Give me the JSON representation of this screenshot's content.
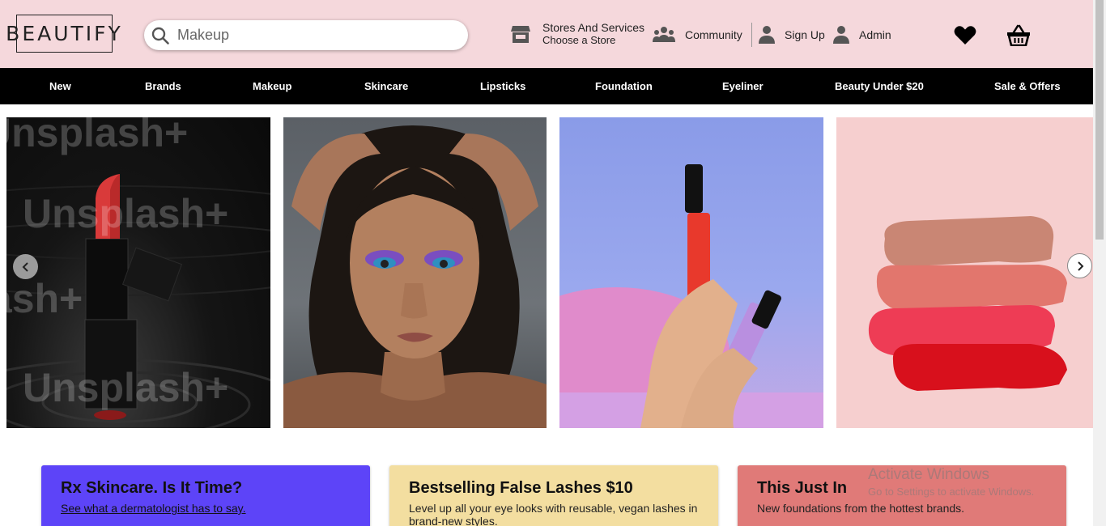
{
  "header": {
    "logo": "BEAUTIFY",
    "search": {
      "placeholder": "Makeup",
      "value": ""
    },
    "store": {
      "line1": "Stores And Services",
      "line2": "Choose a Store"
    },
    "community": "Community",
    "signup": "Sign Up",
    "admin": "Admin"
  },
  "nav": [
    "New",
    "Brands",
    "Makeup",
    "Skincare",
    "Lipsticks",
    "Foundation",
    "Eyeliner",
    "Beauty Under $20",
    "Sale & Offers"
  ],
  "carousel": {
    "watermark": "Unsplash+",
    "slides": [
      "lipstick-photo",
      "makeup-model-photo",
      "lip-gloss-hands-photo",
      "lipstick-swatches-photo"
    ]
  },
  "promos": [
    {
      "title": "Rx Skincare. Is It Time?",
      "text": "See what a dermatologist has to say."
    },
    {
      "title": "Bestselling False Lashes $10",
      "text": "Level up all your eye looks with reusable, vegan lashes in brand-new styles."
    },
    {
      "title": "This Just In",
      "text": "New foundations from the hottest brands."
    }
  ],
  "watermark": {
    "line1": "Activate Windows",
    "line2": "Go to Settings to activate Windows."
  },
  "colors": {
    "header_bg": "#f5d8dc",
    "nav_bg": "#000000",
    "promo1": "#5d44f8",
    "promo2": "#f3dea0",
    "promo3": "#e07a78"
  }
}
